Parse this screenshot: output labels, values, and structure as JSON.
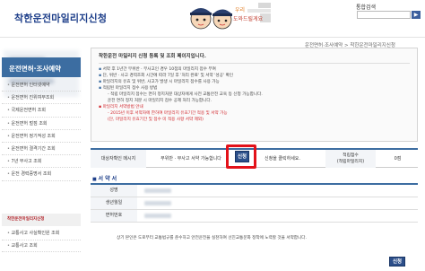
{
  "header": {
    "site_title": "착한운전마일리지신청",
    "search_label": "통합검색",
    "search_button": "▶"
  },
  "breadcrumb": "운전면허·조사예약 > 착한운전마일리지신청",
  "sidebar": {
    "menu_title": "운전면허·조사예약",
    "items": [
      "운전면허 인터넷예약",
      "운전면허 진위여부조회",
      "국제운전면허 조회",
      "운전면허 벌점 조회",
      "운전면허 정기적성 조회",
      "운전면허 결격기간 조회",
      "7년 무사고 조회",
      "운전 경력증명서 조회"
    ],
    "sub_title": "착한운전마일리지신청",
    "sub_items": [
      "교통사고 사실확인원 조회",
      "교통사고 조회"
    ]
  },
  "notice": {
    "title": "착한운전 마일리지 신청 등록 및 조회 페이지입니다.",
    "lines": [
      "서약 후 1년간 무위반 · 무사고인 경우 10점의 마일리지 점수 부여",
      "단, 위반 · 사고 경력조회 시간에 따라 7일 후 '처리 완료' 및 서약 '성공' 확인",
      "마일리지의 유효 및 위반, 사고가 발생 시 마일리지 점수를 사용 가능",
      "적립된 마일리지 점수 사용 방법"
    ],
    "sub_lines": [
      "- 적립 마일리지 점수는 면허 정지처분 대상자에게 사전 교통안전 교육 등 신청 가능합니다.",
      "  운전 면허 정지 처분 시 마일리지 점수 공제 처리 가능합니다."
    ],
    "red_title": "마일리지 서약방법 안내",
    "red_lines": [
      "- 2015년 이후 서약자에 한하여 마일리지 유효기간 적용 및 서약 가능",
      "  (단, 마일리지 유효기간 및 점수 미 적용 사항 서약 제외)"
    ]
  },
  "selection": {
    "type_header": "대상자확인 메시지",
    "type_value": "무위반 · 무사고 서약 가능합니다",
    "apply_small": "신청",
    "status_value": "신청을 클릭하세요.",
    "score_header_1": "적립점수",
    "score_header_2": "(적립마일리지)",
    "score_value": "0점"
  },
  "pledge": {
    "title": "서 약 서",
    "rows": [
      "성명",
      "생년월일",
      "면허번호"
    ],
    "text": "상기 본인은 도로부터 교통법규를 준수하고 안전운전을 실천하여 선진교통문화 정착에 노력할 것을 서약합니다."
  },
  "apply_button": "신청"
}
